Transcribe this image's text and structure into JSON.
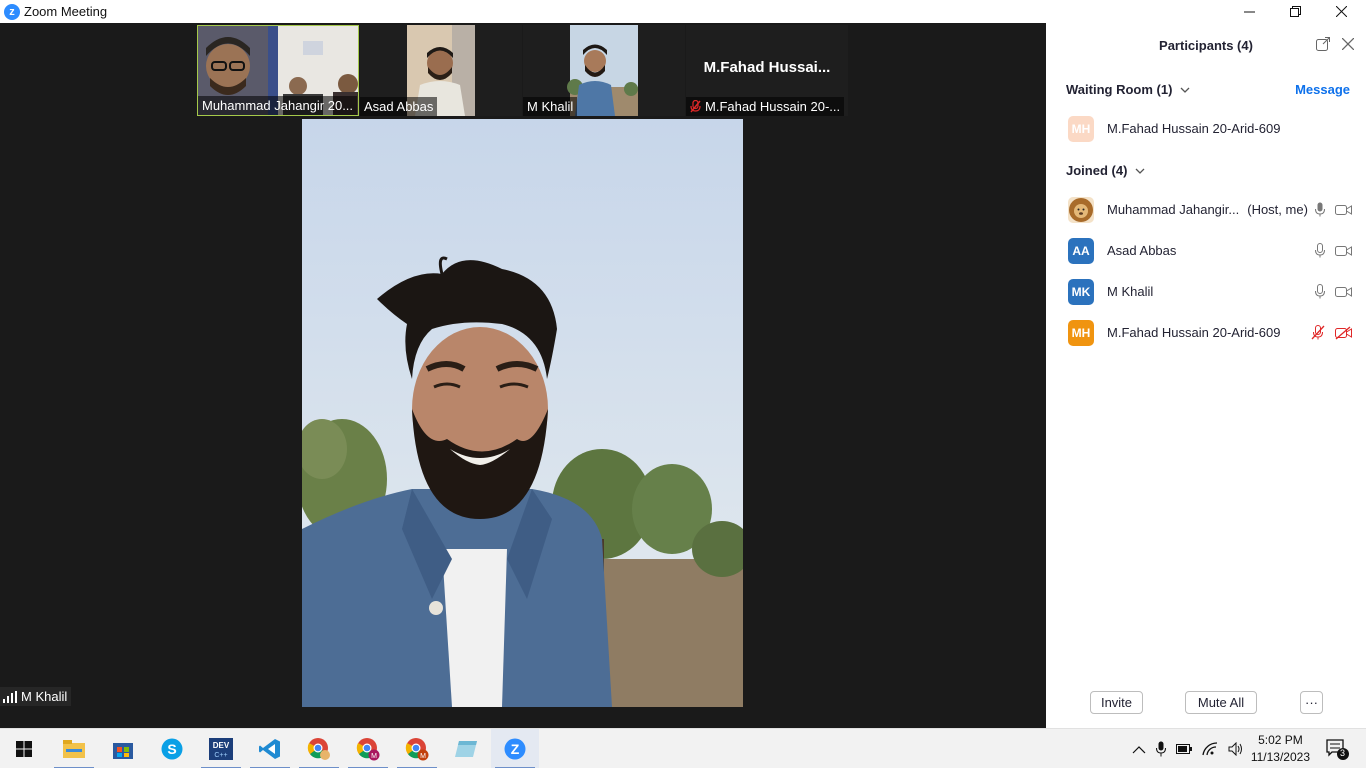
{
  "window": {
    "title": "Zoom Meeting",
    "controls": [
      "minimize",
      "restore",
      "close"
    ]
  },
  "gallery": [
    {
      "name": "Muhammad Jahangir 20...",
      "active": true,
      "muted": false
    },
    {
      "name": "Asad Abbas",
      "active": false,
      "muted": false
    },
    {
      "name": "M Khalil",
      "active": false,
      "muted": false
    },
    {
      "name": "M.Fahad Hussain 20-...",
      "display_name": "M.Fahad  Hussai...",
      "active": false,
      "muted": true
    }
  ],
  "main_video": {
    "speaker": "M Khalil"
  },
  "participants_panel": {
    "title": "Participants (4)",
    "waiting_room": {
      "label": "Waiting Room (1)",
      "message_link": "Message",
      "people": [
        {
          "initials": "MH",
          "name": "M.Fahad Hussain 20-Arid-609",
          "color": "#fbd9c5"
        }
      ]
    },
    "joined": {
      "label": "Joined (4)",
      "people": [
        {
          "initials": "",
          "avatar": "lion-avatar",
          "name": "Muhammad Jahangir...",
          "meta": "(Host, me)",
          "mic": "on",
          "video": "on"
        },
        {
          "initials": "AA",
          "name": "Asad Abbas",
          "color": "#2b72bd",
          "meta": "",
          "mic": "on",
          "video": "on"
        },
        {
          "initials": "MK",
          "name": "M Khalil",
          "color": "#2b72bd",
          "meta": "",
          "mic": "on",
          "video": "on"
        },
        {
          "initials": "MH",
          "name": "M.Fahad Hussain 20-Arid-609",
          "color": "#f09410",
          "meta": "",
          "mic": "muted",
          "video": "off"
        }
      ]
    },
    "buttons": {
      "invite": "Invite",
      "mute_all": "Mute All",
      "more": "···"
    }
  },
  "taskbar": {
    "apps": [
      "start",
      "file-explorer",
      "microsoft-store",
      "skype",
      "dev-c++",
      "vs-code",
      "chrome",
      "chrome-profile-m",
      "chrome-profile-m2",
      "notes",
      "zoom"
    ],
    "time": "5:02 PM",
    "date": "11/13/2023",
    "notification_count": "3"
  },
  "colors": {
    "video_bg": "#1a1a1a",
    "accent": "#0e71eb",
    "active_border": "#a5c94a",
    "muted_red": "#e02828"
  }
}
